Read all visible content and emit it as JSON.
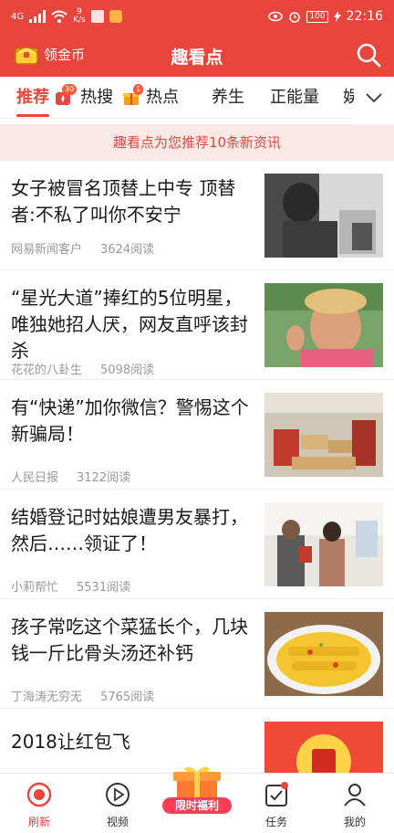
{
  "status_bar": {
    "signal": "4G",
    "speed_value": "9",
    "speed_unit": "K/s",
    "battery": "100",
    "time": "22:16"
  },
  "header": {
    "coin_label": "领金币",
    "title": "趣看点"
  },
  "tabs": [
    {
      "label": "推荐",
      "active": true
    },
    {
      "label": "热搜",
      "badge": "30"
    },
    {
      "label": "热点",
      "badge": "1"
    },
    {
      "label": "养生"
    },
    {
      "label": "正能量"
    },
    {
      "label": "娱"
    }
  ],
  "notice": "趣看点为您推荐10条新资讯",
  "news": [
    {
      "title": "女子被冒名顶替上中专 顶替者:不私了叫你不安宁",
      "source": "网易新闻客户",
      "reads": "3624阅读"
    },
    {
      "title": "“星光大道”捧红的5位明星，唯独她招人厌，网友直呼该封杀",
      "source": "花花的八卦生",
      "reads": "5098阅读"
    },
    {
      "title": "有“快递”加你微信？警惕这个新骗局！",
      "source": "人民日报",
      "reads": "3122阅读"
    },
    {
      "title": "结婚登记时姑娘遭男友暴打，然后……领证了！",
      "source": "小莉帮忙",
      "reads": "5531阅读"
    },
    {
      "title": "孩子常吃这个菜猛长个，几块钱一斤比骨头汤还补钙",
      "source": "丁海涛无穷无",
      "reads": "5765阅读"
    },
    {
      "title": "2018让红包飞",
      "source": "",
      "reads": ""
    }
  ],
  "bottom_nav": {
    "refresh": "刷新",
    "video": "视频",
    "promo": "限时福利",
    "tasks": "任务",
    "mine": "我的"
  },
  "colors": {
    "brand": "#e8453c",
    "notice_bg": "#fbe9e8"
  }
}
